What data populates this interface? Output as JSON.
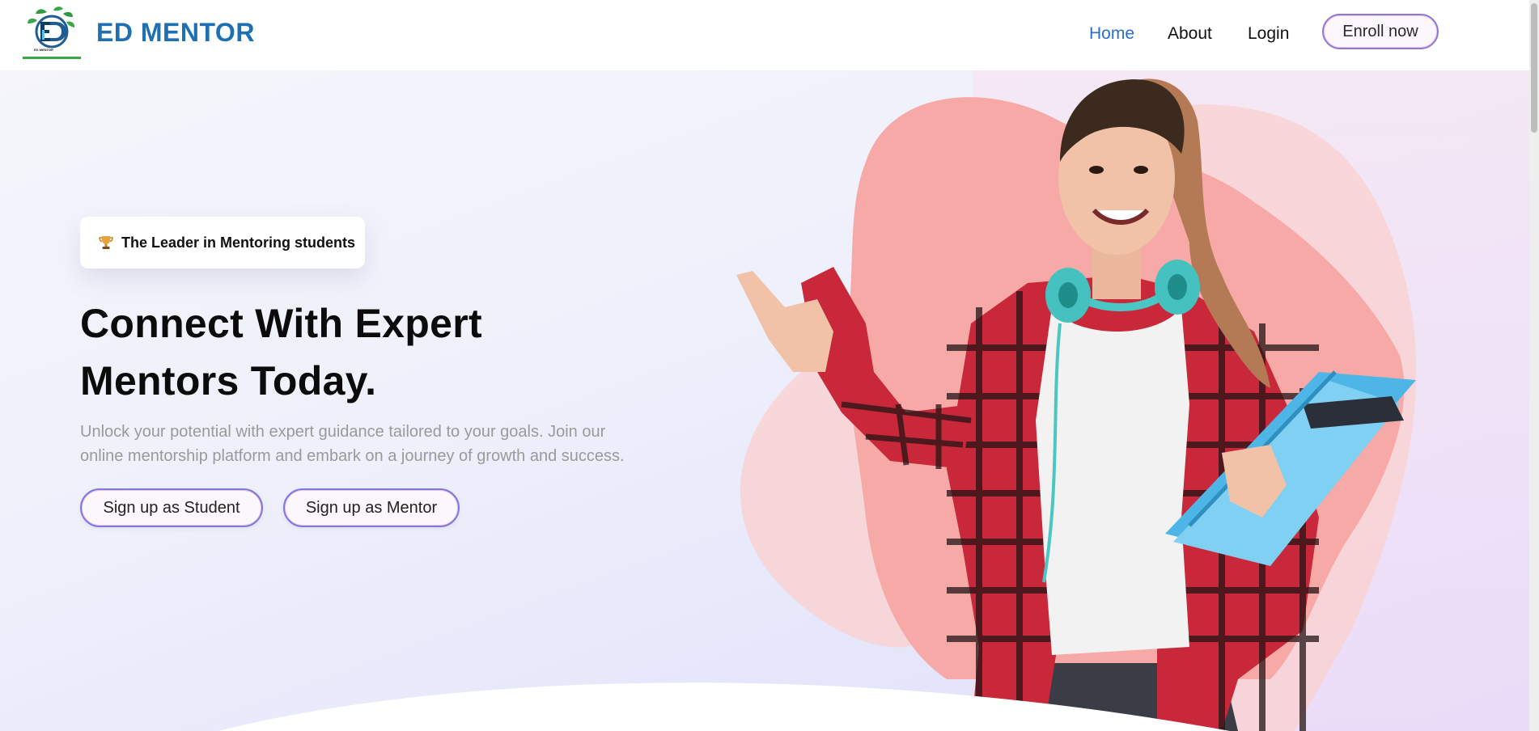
{
  "header": {
    "brand": "ED MENTOR",
    "logo_caption": "ED MENTOR",
    "nav": [
      {
        "label": "Home",
        "active": true
      },
      {
        "label": "About",
        "active": false
      },
      {
        "label": "Login",
        "active": false
      }
    ],
    "enroll_label": "Enroll now"
  },
  "hero": {
    "badge": {
      "icon": "trophy-icon",
      "text": "The Leader in Mentoring students"
    },
    "headline_line1": "Connect With Expert",
    "headline_line2": "Mentors Today.",
    "subtext_line1": "Unlock your potential with expert guidance tailored to your goals. Join our",
    "subtext_line2": "online mentorship platform and embark on a journey of growth and success.",
    "buttons": {
      "student": "Sign up as Student",
      "mentor": "Sign up as Mentor"
    }
  },
  "colors": {
    "brand": "#1f6fb3",
    "nav_active": "#2a6fc4",
    "blob": "#f7a9a7",
    "blob_light": "#f9d2d3",
    "button_border": "#7d77de"
  }
}
